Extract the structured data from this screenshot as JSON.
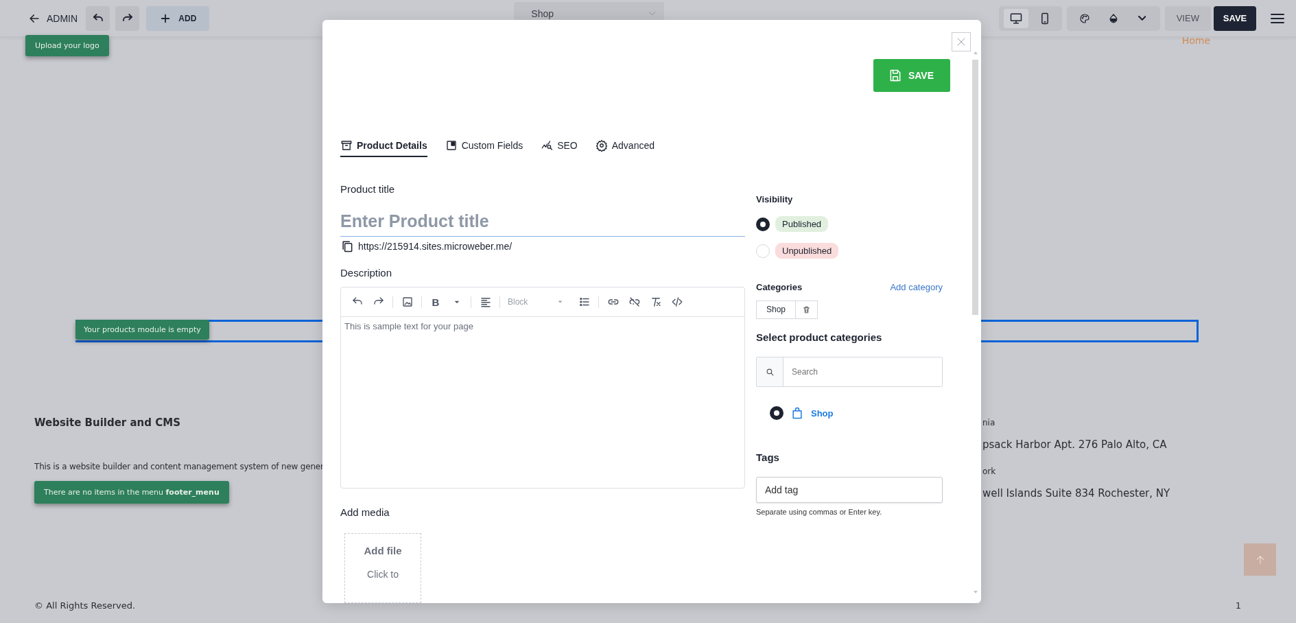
{
  "top_bar": {
    "back_label": "ADMIN",
    "add_label": "ADD",
    "page_select": "Shop",
    "device_buttons": [
      {
        "kind": "desktop",
        "selected": true
      },
      {
        "kind": "mobile",
        "selected": false
      }
    ],
    "view_label": "VIEW",
    "save_label": "SAVE"
  },
  "site": {
    "nav_link": "Home",
    "logo_notice": "Upload your logo",
    "products_notice": "Your products module is empty",
    "footer_title": "Website Builder and CMS",
    "footer_text": "This is a website builder and content management system of new gener",
    "menu_notice": "There are no items in the menu **footer_menu**",
    "addresses": [
      {
        "city": "nia",
        "address": "psack Harbor Apt. 276 Palo Alto, CA"
      },
      {
        "city": "ork",
        "address": "well Islands Suite 834 Rochester, NY"
      }
    ],
    "copyright": "© All Rights Reserved.",
    "page_number": "1"
  },
  "modal": {
    "save_label": "SAVE",
    "tabs": [
      {
        "label": "Product Details",
        "kind": "archive",
        "selected": true
      },
      {
        "label": "Custom Fields",
        "kind": "fields",
        "selected": false
      },
      {
        "label": "SEO",
        "kind": "seo",
        "selected": false
      },
      {
        "label": "Advanced",
        "kind": "gear",
        "selected": false
      }
    ],
    "title_label": "Product title",
    "title_placeholder": "Enter Product title",
    "url": "https://215914.sites.microweber.me/",
    "description_label": "Description",
    "editor": {
      "bold_label": "B",
      "block_select": "Block",
      "text": "This is sample text for your page"
    },
    "media_label": "Add media",
    "add_file": {
      "title": "Add file",
      "hint": "Click to"
    },
    "visibility": {
      "label": "Visibility",
      "options": [
        {
          "label": "Published",
          "selected": true,
          "color": "#e1efdf"
        },
        {
          "label": "Unpublished",
          "selected": false,
          "color": "#fbdcdc"
        }
      ]
    },
    "categories": {
      "label": "Categories",
      "add_link": "Add category",
      "chips": [
        "Shop"
      ],
      "select_label": "Select product categories",
      "search_placeholder": "Search",
      "tree": [
        {
          "label": "Shop",
          "selected": true
        }
      ]
    },
    "tags": {
      "label": "Tags",
      "placeholder": "Add tag",
      "hint": "Separate using commas or Enter key."
    }
  }
}
